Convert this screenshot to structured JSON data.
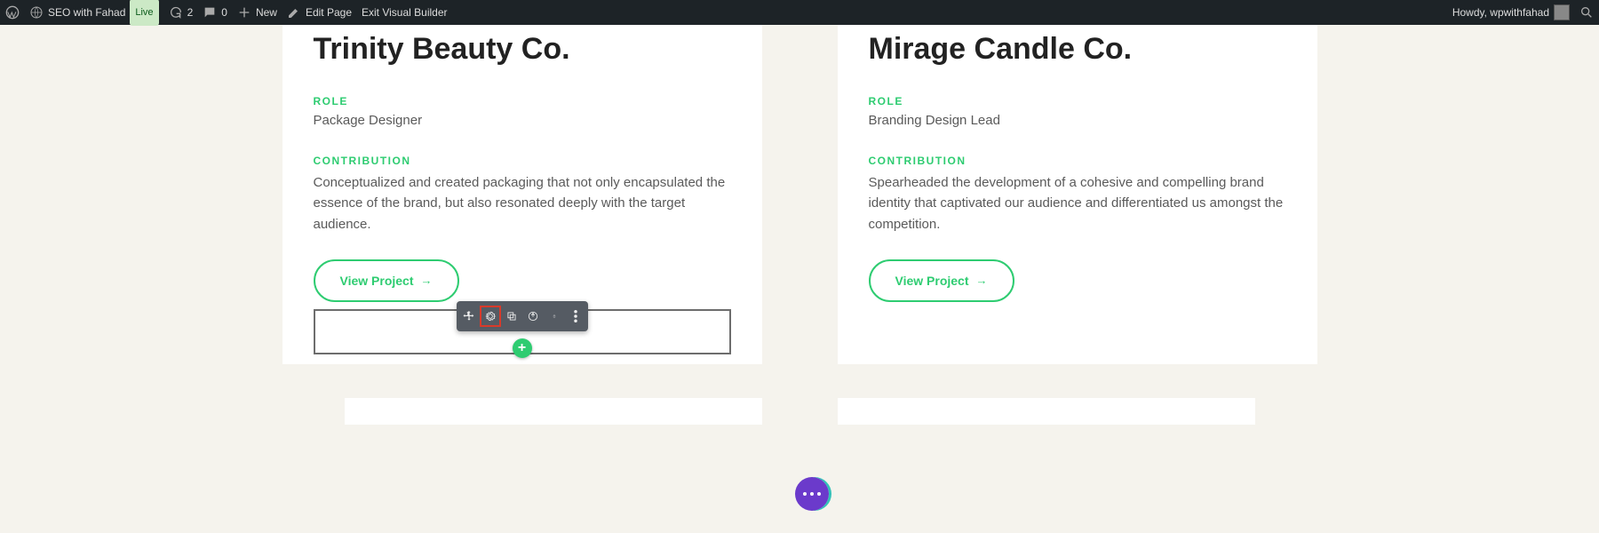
{
  "adminbar": {
    "site": "SEO with Fahad",
    "live": "Live",
    "updates": "2",
    "comments": "0",
    "new": "New",
    "editpage": "Edit Page",
    "exitvb": "Exit Visual Builder",
    "howdy": "Howdy, wpwithfahad"
  },
  "cards": [
    {
      "title": "Trinity Beauty Co.",
      "role_label": "ROLE",
      "role_value": "Package Designer",
      "contrib_label": "CONTRIBUTION",
      "contrib_text": "Conceptualized and created packaging that not only encapsulated the essence of the brand, but also resonated deeply with the target audience.",
      "button": "View Project"
    },
    {
      "title": "Mirage Candle Co.",
      "role_label": "ROLE",
      "role_value": "Branding Design Lead",
      "contrib_label": "CONTRIBUTION",
      "contrib_text": "Spearheaded the development of a cohesive and compelling brand identity that captivated our audience and differentiated us amongst the competition.",
      "button": "View Project"
    }
  ],
  "toolbar": {
    "items": [
      "move",
      "settings",
      "duplicate",
      "save",
      "delete",
      "more"
    ]
  }
}
